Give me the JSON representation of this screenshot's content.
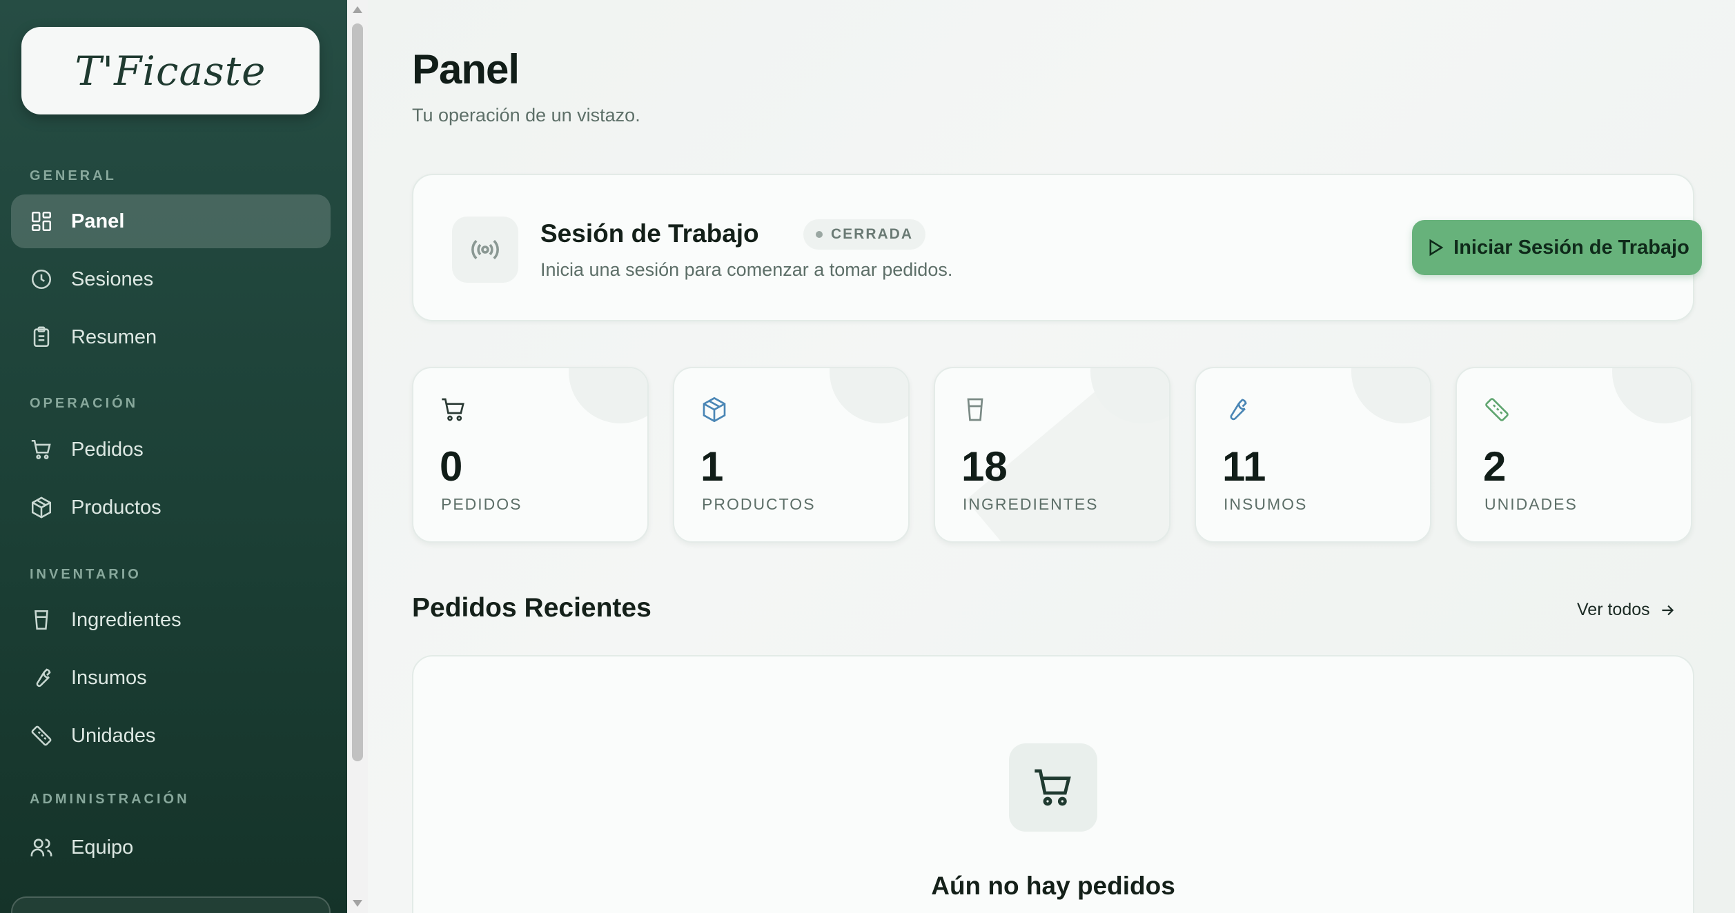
{
  "brand": {
    "logo_text": "T'Ficaste"
  },
  "sidebar": {
    "sections": [
      {
        "label": "GENERAL"
      },
      {
        "label": "OPERACIÓN"
      },
      {
        "label": "INVENTARIO"
      },
      {
        "label": "ADMINISTRACIÓN"
      }
    ],
    "items": [
      {
        "label": "Panel",
        "icon": "dashboard-icon",
        "active": true
      },
      {
        "label": "Sesiones",
        "icon": "clock-icon"
      },
      {
        "label": "Resumen",
        "icon": "clipboard-icon"
      },
      {
        "label": "Pedidos",
        "icon": "cart-icon"
      },
      {
        "label": "Productos",
        "icon": "package-icon"
      },
      {
        "label": "Ingredientes",
        "icon": "cup-icon"
      },
      {
        "label": "Insumos",
        "icon": "wrench-icon"
      },
      {
        "label": "Unidades",
        "icon": "ruler-icon"
      },
      {
        "label": "Equipo",
        "icon": "users-icon"
      }
    ]
  },
  "header": {
    "title": "Panel",
    "subtitle": "Tu operación de un vistazo."
  },
  "session": {
    "title": "Sesión de Trabajo",
    "status": "CERRADA",
    "description": "Inicia una sesión para comenzar a tomar pedidos.",
    "button_label": "Iniciar Sesión de Trabajo",
    "icon": "broadcast-icon"
  },
  "stats": [
    {
      "value": "0",
      "label": "PEDIDOS",
      "icon": "cart-icon"
    },
    {
      "value": "1",
      "label": "PRODUCTOS",
      "icon": "package-icon"
    },
    {
      "value": "18",
      "label": "INGREDIENTES",
      "icon": "cup-icon"
    },
    {
      "value": "11",
      "label": "INSUMOS",
      "icon": "wrench-icon"
    },
    {
      "value": "2",
      "label": "UNIDADES",
      "icon": "ruler-icon"
    }
  ],
  "recent_orders": {
    "title": "Pedidos Recientes",
    "see_all": "Ver todos",
    "empty_title": "Aún no hay pedidos"
  },
  "colors": {
    "sidebar_bg": "#1c4036",
    "accent_green": "#67b27b",
    "stat_icon_blue": "#4a86b5"
  }
}
